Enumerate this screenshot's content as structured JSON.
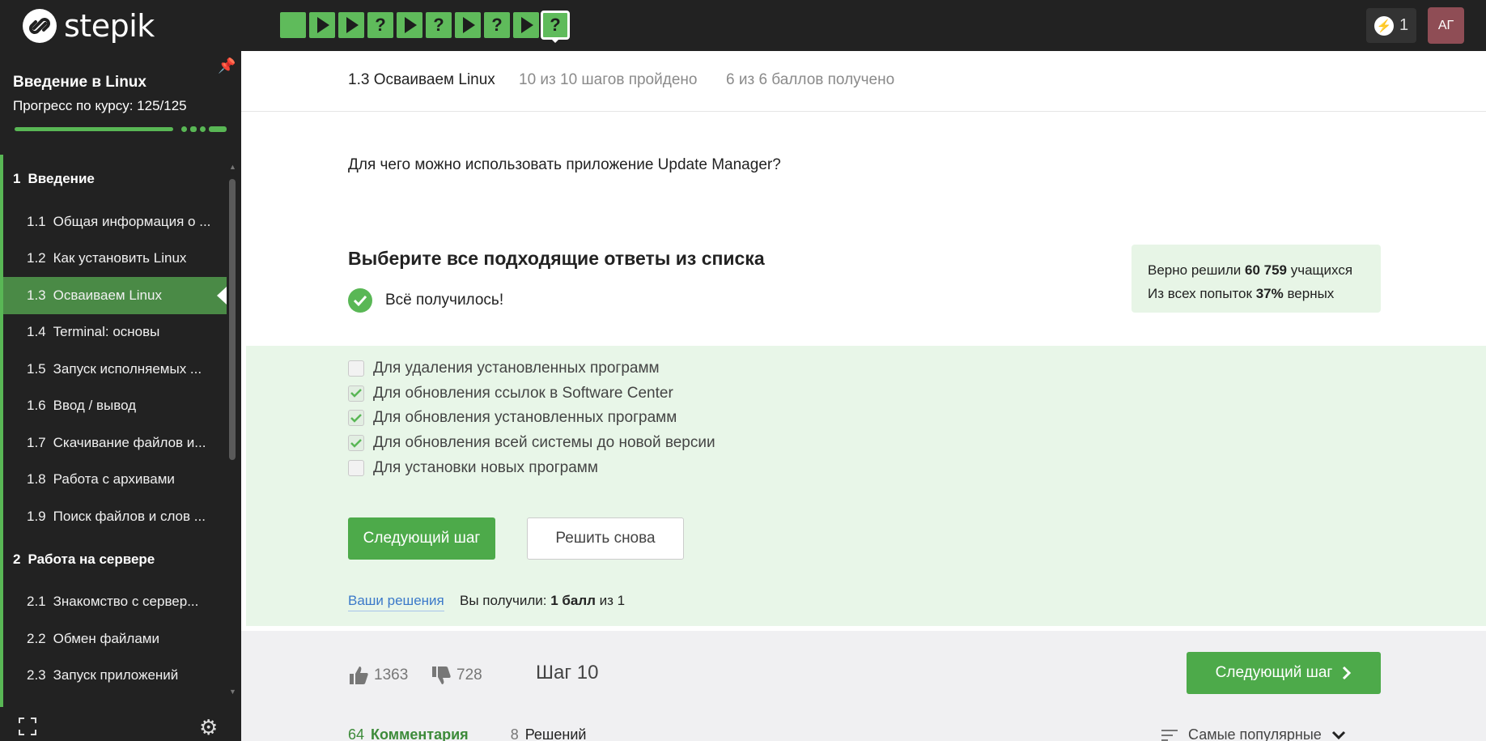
{
  "topbar": {
    "brand": "stepik",
    "steps": [
      {
        "type": "square"
      },
      {
        "type": "play"
      },
      {
        "type": "play"
      },
      {
        "type": "question",
        "label": "?"
      },
      {
        "type": "play"
      },
      {
        "type": "question",
        "label": "?"
      },
      {
        "type": "play"
      },
      {
        "type": "question",
        "label": "?"
      },
      {
        "type": "play"
      },
      {
        "type": "question",
        "label": "?",
        "current": true
      }
    ],
    "energy_count": "1",
    "avatar_initials": "АГ"
  },
  "sidebar": {
    "course_title": "Введение в Linux",
    "progress_label": "Прогресс по курсу:  125/125",
    "progress_fraction": 1.0,
    "sections": [
      {
        "num": "1",
        "title": "Введение",
        "lessons": [
          {
            "num": "1.1",
            "title": "Общая информация о ..."
          },
          {
            "num": "1.2",
            "title": "Как установить Linux"
          },
          {
            "num": "1.3",
            "title": "Осваиваем Linux",
            "active": true
          },
          {
            "num": "1.4",
            "title": "Terminal: основы"
          },
          {
            "num": "1.5",
            "title": "Запуск исполняемых ..."
          },
          {
            "num": "1.6",
            "title": "Ввод / вывод"
          },
          {
            "num": "1.7",
            "title": "Скачивание файлов и..."
          },
          {
            "num": "1.8",
            "title": "Работа с архивами"
          },
          {
            "num": "1.9",
            "title": "Поиск файлов и слов ..."
          }
        ]
      },
      {
        "num": "2",
        "title": "Работа на сервере",
        "lessons": [
          {
            "num": "2.1",
            "title": "Знакомство с сервер..."
          },
          {
            "num": "2.2",
            "title": "Обмен файлами"
          },
          {
            "num": "2.3",
            "title": "Запуск приложений"
          }
        ]
      }
    ]
  },
  "lesson_header": {
    "title": "1.3 Осваиваем Linux",
    "steps_done": "10 из 10 шагов пройдено",
    "score": "6 из 6 баллов  получено"
  },
  "quiz": {
    "question": "Для чего можно использовать приложение Update Manager?",
    "title": "Выберите все подходящие ответы из списка",
    "success_text": "Всё получилось!",
    "stats": {
      "line1_prefix": "Верно решили ",
      "solved_count": "60 759",
      "line1_suffix": " учащихся",
      "line2_prefix": "Из всех попыток ",
      "correct_pct": "37%",
      "line2_suffix": " верных"
    },
    "options": [
      {
        "label": "Для удаления установленных программ",
        "checked": false
      },
      {
        "label": "Для обновления ссылок в Software Center",
        "checked": true
      },
      {
        "label": "Для обновления установленных программ",
        "checked": true
      },
      {
        "label": "Для обновления всей системы до новой версии",
        "checked": true
      },
      {
        "label": "Для установки новых программ",
        "checked": false
      }
    ],
    "next_button": "Следующий шаг",
    "retry_button": "Решить снова",
    "your_solutions_link": "Ваши решения",
    "score_prefix": "Вы получили: ",
    "score_value": "1 балл",
    "score_suffix": " из 1"
  },
  "footer": {
    "likes": "1363",
    "dislikes": "728",
    "step_label": "Шаг 10",
    "next_button": "Следующий шаг",
    "comments_count": "64",
    "comments_label": "Комментария",
    "solutions_count": "8",
    "solutions_label": "Решений",
    "sort_label": "Самые популярные"
  },
  "colors": {
    "brand_green": "#59b755",
    "dark_bg": "#222222",
    "answer_bg": "#e8f6e8",
    "link_blue": "#3b79c9"
  }
}
